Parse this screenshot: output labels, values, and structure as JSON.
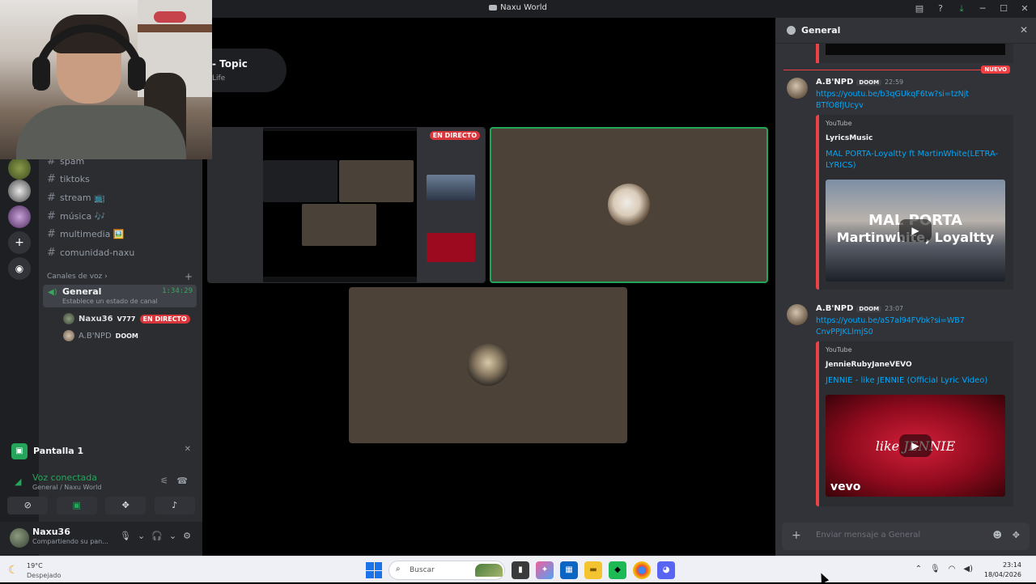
{
  "window": {
    "title": "Naxu World",
    "controls": [
      "inbox-icon",
      "help-icon",
      "download-icon",
      "minimize-icon",
      "maximize-icon",
      "close-icon"
    ]
  },
  "colors": {
    "accent_green": "#23a55a",
    "live_red": "#da373c",
    "link_blue": "#00a8fc",
    "sidebar_bg": "#2b2d31",
    "chat_bg": "#313338"
  },
  "topic": {
    "title": "- Topic",
    "subtitle": "Life"
  },
  "channels": {
    "text": [
      {
        "name": "spam"
      },
      {
        "name": "tiktoks"
      },
      {
        "name": "stream 📺"
      },
      {
        "name": "música 🎶"
      },
      {
        "name": "multimedia 🖼️"
      },
      {
        "name": "comunidad-naxu"
      }
    ],
    "voice_header": "Canales de voz",
    "voice_channel": {
      "name": "General",
      "timer": "1:34:29",
      "status": "Establece un estado de canal"
    },
    "voice_users": [
      {
        "name": "Naxu36",
        "tag": "V777",
        "live": "EN DIRECTO"
      },
      {
        "name": "A.B'NPD",
        "tag": "DOOM"
      }
    ]
  },
  "screen_share": {
    "label": "Pantalla 1"
  },
  "voice_connection": {
    "status": "Voz conectada",
    "location": "General / Naxu World"
  },
  "user": {
    "name": "Naxu36",
    "status": "Compartiendo su pan..."
  },
  "stage": {
    "live_badge": "EN DIRECTO"
  },
  "chat": {
    "channel": "General",
    "new_badge": "NUEVO",
    "messages": [
      {
        "author": "A.B'NPD",
        "tag": "DOOM",
        "time": "22:59",
        "link": "https://youtu.be/b3qGUkqF6tw?si=tzNjtBTfO8fJUcyv",
        "embed": {
          "provider": "YouTube",
          "author": "LyricsMusic",
          "title": "MAL PORTA-Loyaltty ft MartinWhite(LETRA-LYRICS)",
          "thumb_text_1": "MAL PORTA",
          "thumb_text_2": "Martinwhite, Loyaltty"
        }
      },
      {
        "author": "A.B'NPD",
        "tag": "DOOM",
        "time": "23:07",
        "link": "https://youtu.be/aS7al94FVbk?si=WB7CnvPPJKLlmjS0",
        "embed": {
          "provider": "YouTube",
          "author": "JennieRubyJaneVEVO",
          "title": "JENNIE - like JENNIE (Official Lyric Video)",
          "thumb_text": "like JENNIE",
          "vevo": "vevo"
        }
      }
    ],
    "composer_placeholder": "Enviar mensaje a General"
  },
  "taskbar": {
    "temperature": "19°C",
    "weather": "Despejado",
    "search_placeholder": "Buscar",
    "time": "23:14",
    "date": "18/04/2026"
  }
}
